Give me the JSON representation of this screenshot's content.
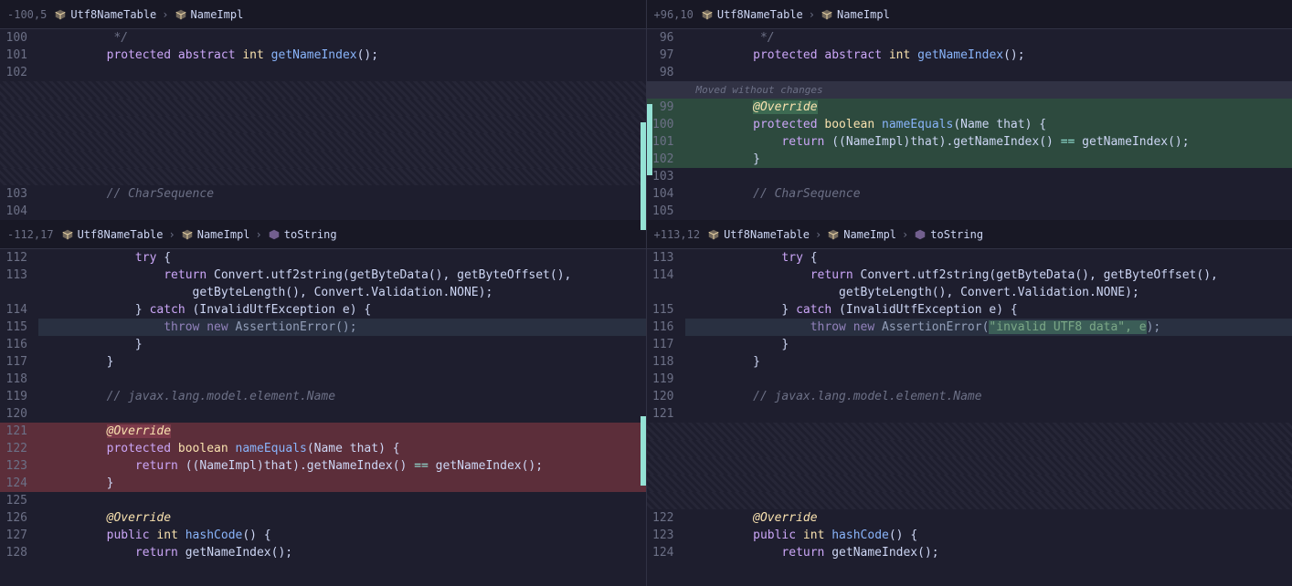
{
  "left": {
    "hunk1": "-100,5",
    "bc1": [
      "Utf8NameTable",
      "NameImpl"
    ],
    "hunk2": "-112,17",
    "bc2": [
      "Utf8NameTable",
      "NameImpl",
      "toString"
    ]
  },
  "right": {
    "hunk1": "+96,10",
    "bc1": [
      "Utf8NameTable",
      "NameImpl"
    ],
    "hunk2": "+113,12",
    "bc2": [
      "Utf8NameTable",
      "NameImpl",
      "toString"
    ],
    "moved_label": "Moved without changes"
  },
  "k": {
    "protected": "protected",
    "abstract": "abstract",
    "int": "int",
    "boolean": "boolean",
    "return": "return",
    "try": "try",
    "catch": "catch",
    "throw": "throw",
    "new": "new",
    "public": "public"
  },
  "sym": {
    "override": "@Override",
    "getNameIndex": "getNameIndex",
    "nameEquals": "nameEquals",
    "hashCode": "hashCode",
    "toString_body1": "Convert.utf2string(getByteData(), getByteOffset(),",
    "toString_body2": "getByteLength(), Convert.Validation.NONE);",
    "catch_param": "(InvalidUtfException e) {",
    "assertErr": "AssertionError",
    "assertArg": "\"invalid UTF8 data\", e",
    "nameimpl_cast": "((NameImpl)that).getNameIndex()",
    "eqeq": "==",
    "call_gni": "getNameIndex();",
    "name_that": "(Name that) {",
    "paren_semi": "();",
    "paren_semi2": "();",
    "paren_brace": "() {"
  },
  "c": {
    "star_close": "*/",
    "charseq": "// CharSequence",
    "name_model": "// javax.lang.model.element.Name"
  },
  "ln": {
    "l1": [
      "100",
      "101",
      "102",
      "",
      "",
      "",
      "",
      "",
      "",
      "103",
      "104"
    ],
    "r1": [
      "96",
      "97",
      "98",
      "",
      "99",
      "100",
      "101",
      "102",
      "103",
      "104",
      "105"
    ],
    "l2": [
      "112",
      "113",
      "",
      "114",
      "115",
      "116",
      "117",
      "118",
      "119",
      "120",
      "121",
      "122",
      "123",
      "124",
      "125",
      "126",
      "127",
      "128"
    ],
    "r2": [
      "113",
      "114",
      "",
      "115",
      "116",
      "117",
      "118",
      "119",
      "120",
      "121",
      "",
      "",
      "",
      "",
      "",
      "122",
      "123",
      "124"
    ]
  }
}
